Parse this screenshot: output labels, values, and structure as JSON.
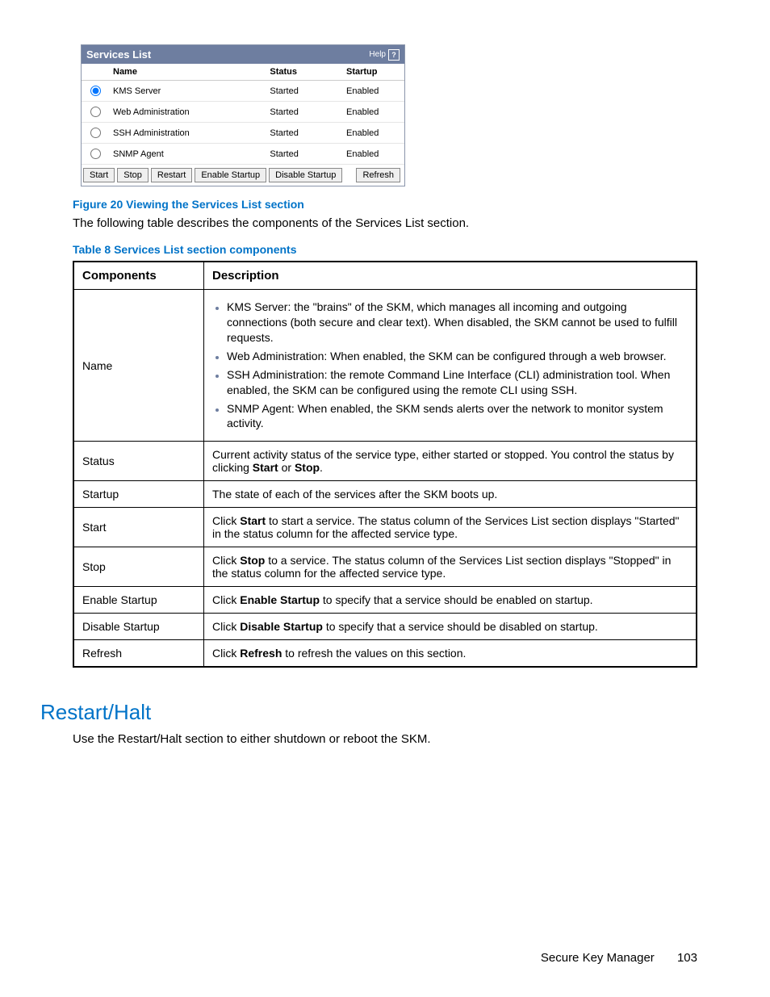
{
  "panel": {
    "title": "Services List",
    "help_label": "Help",
    "headers": {
      "name": "Name",
      "status": "Status",
      "startup": "Startup"
    },
    "rows": [
      {
        "name": "KMS Server",
        "status": "Started",
        "startup": "Enabled",
        "selected": true
      },
      {
        "name": "Web Administration",
        "status": "Started",
        "startup": "Enabled",
        "selected": false
      },
      {
        "name": "SSH Administration",
        "status": "Started",
        "startup": "Enabled",
        "selected": false
      },
      {
        "name": "SNMP Agent",
        "status": "Started",
        "startup": "Enabled",
        "selected": false
      }
    ],
    "buttons": {
      "start": "Start",
      "stop": "Stop",
      "restart": "Restart",
      "enable": "Enable Startup",
      "disable": "Disable Startup",
      "refresh": "Refresh"
    }
  },
  "figure_caption": "Figure 20 Viewing the Services List section",
  "intro_text": "The following table describes the components of the Services List section.",
  "table_caption": "Table 8 Services List section components",
  "table": {
    "headers": {
      "comp": "Components",
      "desc": "Description"
    },
    "name_row_label": "Name",
    "name_bullets": [
      "KMS Server: the \"brains\" of the SKM, which manages all incoming and outgoing connections (both secure and clear text). When disabled, the SKM cannot be used to fulfill requests.",
      "Web Administration: When enabled, the SKM can be configured through a web browser.",
      "SSH Administration: the remote Command Line Interface (CLI) administration tool. When enabled, the SKM can be configured using the remote CLI using SSH.",
      "SNMP Agent: When enabled, the SKM sends alerts over the network to monitor system activity."
    ],
    "rows": [
      {
        "comp": "Status",
        "prefix": "Current activity status of the service type, either started or stopped. You control the status by clicking ",
        "bold1": "Start",
        "mid": " or ",
        "bold2": "Stop",
        "suffix": "."
      },
      {
        "comp": "Startup",
        "prefix": "The state of each of the services after the SKM boots up.",
        "bold1": "",
        "mid": "",
        "bold2": "",
        "suffix": ""
      },
      {
        "comp": "Start",
        "prefix": "Click ",
        "bold1": "Start",
        "mid": "",
        "bold2": "",
        "suffix": " to start a service. The status column of the Services List section displays \"Started\" in the status column for the affected service type."
      },
      {
        "comp": "Stop",
        "prefix": "Click ",
        "bold1": "Stop",
        "mid": "",
        "bold2": "",
        "suffix": " to a service. The status column of the Services List section displays \"Stopped\" in the status column for the affected service type."
      },
      {
        "comp": "Enable Startup",
        "prefix": "Click ",
        "bold1": "Enable Startup",
        "mid": "",
        "bold2": "",
        "suffix": " to specify that a service should be enabled on startup."
      },
      {
        "comp": "Disable Startup",
        "prefix": "Click ",
        "bold1": "Disable Startup",
        "mid": "",
        "bold2": "",
        "suffix": " to specify that a service should be disabled on startup."
      },
      {
        "comp": "Refresh",
        "prefix": "Click ",
        "bold1": "Refresh",
        "mid": "",
        "bold2": "",
        "suffix": " to refresh the values on this section."
      }
    ]
  },
  "section": {
    "heading": "Restart/Halt",
    "text": "Use the Restart/Halt section to either shutdown or reboot the SKM."
  },
  "footer": {
    "title": "Secure Key Manager",
    "page": "103"
  }
}
